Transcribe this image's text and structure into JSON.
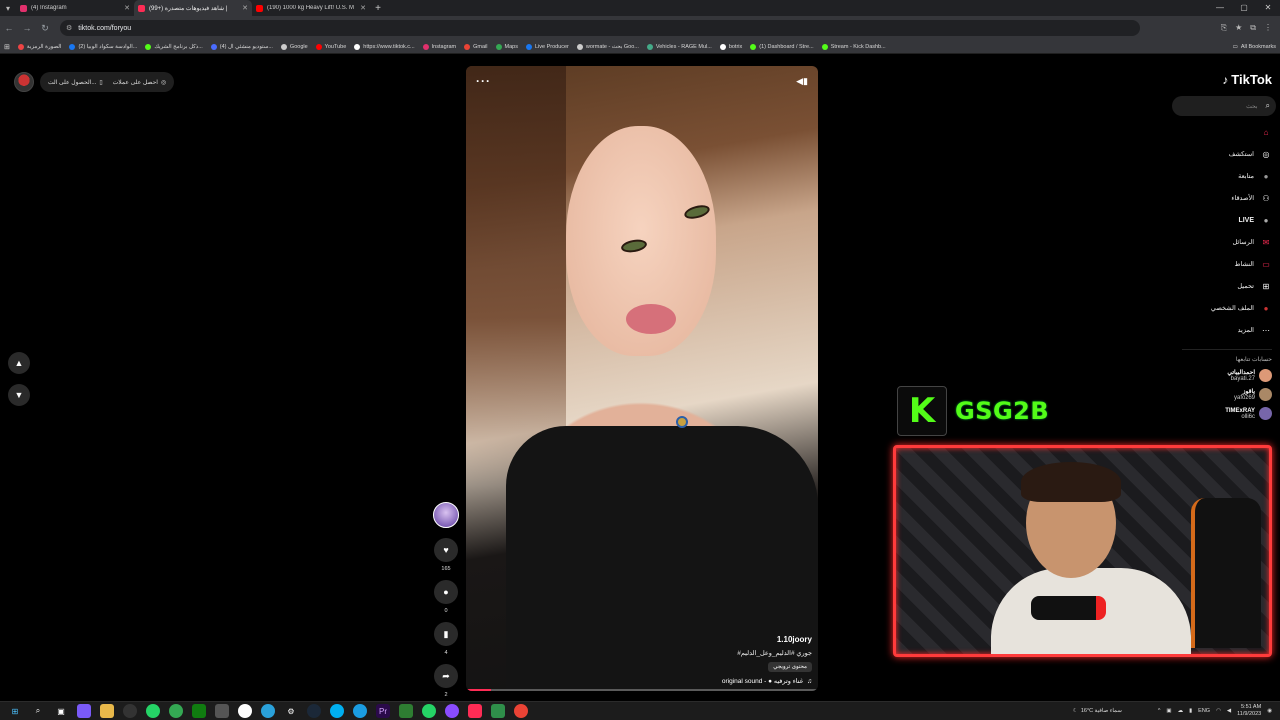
{
  "browser": {
    "tabs": [
      {
        "title": "(4) Instagram",
        "color": "#e1306c",
        "active": false
      },
      {
        "title": "(99+) شاهد فيديوهات متصدرة |",
        "color": "#fe2c55",
        "active": true
      },
      {
        "title": "(190) 1000 kg Heavy Lift! U.S. M",
        "color": "#ff0000",
        "active": false
      }
    ],
    "new_tab": "+",
    "url": "tiktok.com/foryou",
    "bookmarks": [
      {
        "label": "الصورة الرمزية",
        "color": "#e44"
      },
      {
        "label": "(2) الوادسة سكواد الوبيا...",
        "color": "#1877f2"
      },
      {
        "label": "ذكل برنامج الشريك...",
        "color": "#53fc18"
      },
      {
        "label": "(4) ستوديو منشئي ال...",
        "color": "#4a6cff"
      },
      {
        "label": "Google",
        "color": "#ccc"
      },
      {
        "label": "YouTube",
        "color": "#ff0000"
      },
      {
        "label": "https://www.tiktok.c...",
        "color": "#fff"
      },
      {
        "label": "Instagram",
        "color": "#e1306c"
      },
      {
        "label": "Gmail",
        "color": "#ea4335"
      },
      {
        "label": "Maps",
        "color": "#34a853"
      },
      {
        "label": "Live Producer",
        "color": "#1877f2"
      },
      {
        "label": "wormate - بحث Goo...",
        "color": "#ccc"
      },
      {
        "label": "Vehicles - RAGE Mul...",
        "color": "#4a8"
      },
      {
        "label": "botrix",
        "color": "#fff"
      },
      {
        "label": "(1) Dashboard / Stre...",
        "color": "#53fc18"
      },
      {
        "label": "Stream - Kick Dashb...",
        "color": "#53fc18"
      }
    ],
    "all_bookmarks": "All Bookmarks"
  },
  "tiktok": {
    "logo_text": "TikTok",
    "search_placeholder": "بحث",
    "get_coins_a": "احصل على عملات",
    "get_coins_b": "الحصول على الت...",
    "menu": [
      {
        "label": "",
        "icon": "home-icon",
        "glyph": "⌂",
        "color": "#fe2c55"
      },
      {
        "label": "استكشف",
        "icon": "explore-icon",
        "glyph": "◎",
        "color": "#fff"
      },
      {
        "label": "متابعة",
        "icon": "following-icon",
        "glyph": "●",
        "color": "#999"
      },
      {
        "label": "الأصدقاء",
        "icon": "friends-icon",
        "glyph": "⚇",
        "color": "#fff"
      },
      {
        "label": "LIVE",
        "icon": "live-icon",
        "glyph": "●",
        "color": "#aaa"
      },
      {
        "label": "الرسائل",
        "icon": "messages-icon",
        "glyph": "✉",
        "color": "#fe2c55"
      },
      {
        "label": "النشاط",
        "icon": "activity-icon",
        "glyph": "▭",
        "color": "#fe2c55"
      },
      {
        "label": "تحميل",
        "icon": "upload-icon",
        "glyph": "⊞",
        "color": "#fff"
      },
      {
        "label": "الملف الشخصي",
        "icon": "profile-icon",
        "glyph": "●",
        "color": "#c33"
      },
      {
        "label": "المزيد",
        "icon": "more-icon",
        "glyph": "⋯",
        "color": "#fff"
      }
    ],
    "following_title": "حسابات تتابعها",
    "following": [
      {
        "name": "احمدالبياتي",
        "handle": "bayati.27",
        "color": "#d97"
      },
      {
        "name": "ياقوز",
        "handle": "yafoz69",
        "color": "#a86"
      },
      {
        "name": "TIMExRAY",
        "handle": "olli6c",
        "color": "#76a"
      }
    ]
  },
  "video": {
    "username": "1.10joory",
    "caption": "#جوري #الدليم_وعل_الدليم",
    "tag": "محتوى ترويجي",
    "sound": "original sound - ● غناء وترفيه",
    "progress": 0.07,
    "likes": "165",
    "comments": "0",
    "saves": "4",
    "shares": "2"
  },
  "stream_overlay": {
    "kick_letter": "K",
    "channel_name": "GSG2B"
  },
  "taskbar": {
    "weather": "16°C سماء صافية",
    "lang": "ENG",
    "time": "5:51 AM",
    "date": "11/9/2023"
  }
}
